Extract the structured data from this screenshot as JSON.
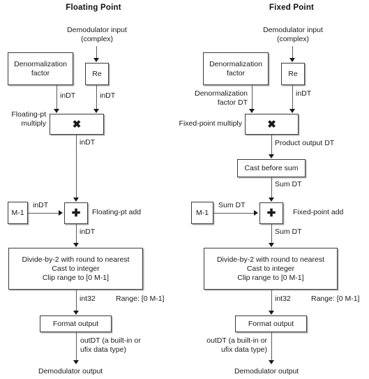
{
  "diagram": {
    "kind": "flow-diagram",
    "panels": [
      {
        "id": "floating",
        "title": "Floating Point",
        "source_label": "Demodulator input\n(complex)",
        "boxes": {
          "denorm": "Denormalization\nfactor",
          "re": "Re",
          "multiply": "✖",
          "add": "✚",
          "m_minus_1": "M-1",
          "divide": "Divide-by-2 with round to nearest\nCast to integer\nClip range to [0 M-1]",
          "format": "Format output"
        },
        "side_labels": {
          "multiply": "Floating-pt\nmultiply",
          "add": "Floating-pt add"
        },
        "edge_labels": {
          "denorm_to_mult": "inDT",
          "re_to_mult": "inDT",
          "mult_to_add": "inDT",
          "m_to_add": "inDT",
          "add_to_divide": "inDT",
          "divide_to_format": "int32",
          "divide_range": "Range: [0 M-1]",
          "format_to_out": "outDT (a built-in or\nufix data type)"
        },
        "output_label": "Demodulator output"
      },
      {
        "id": "fixed",
        "title": "Fixed Point",
        "source_label": "Demodulator input\n(complex)",
        "boxes": {
          "denorm": "Denormalization\nfactor",
          "re": "Re",
          "multiply": "✖",
          "cast": "Cast before sum",
          "add": "✚",
          "m_minus_1": "M-1",
          "divide": "Divide-by-2 with round to nearest\nCast to integer\nClip range to [0 M-1]",
          "format": "Format output"
        },
        "side_labels": {
          "multiply": "Fixed-point multiply",
          "add": "Fixed-point add"
        },
        "edge_labels": {
          "denorm_to_mult": "Denormalization\nfactor DT",
          "re_to_mult": "inDT",
          "mult_to_cast": "Product output DT",
          "cast_to_add": "Sum DT",
          "m_to_add": "Sum DT",
          "add_to_divide": "Sum DT",
          "divide_to_format": "int32",
          "divide_range": "Range: [0 M-1]",
          "format_to_out": "outDT (a built-in or\nufix data type)"
        },
        "output_label": "Demodulator output"
      }
    ]
  }
}
